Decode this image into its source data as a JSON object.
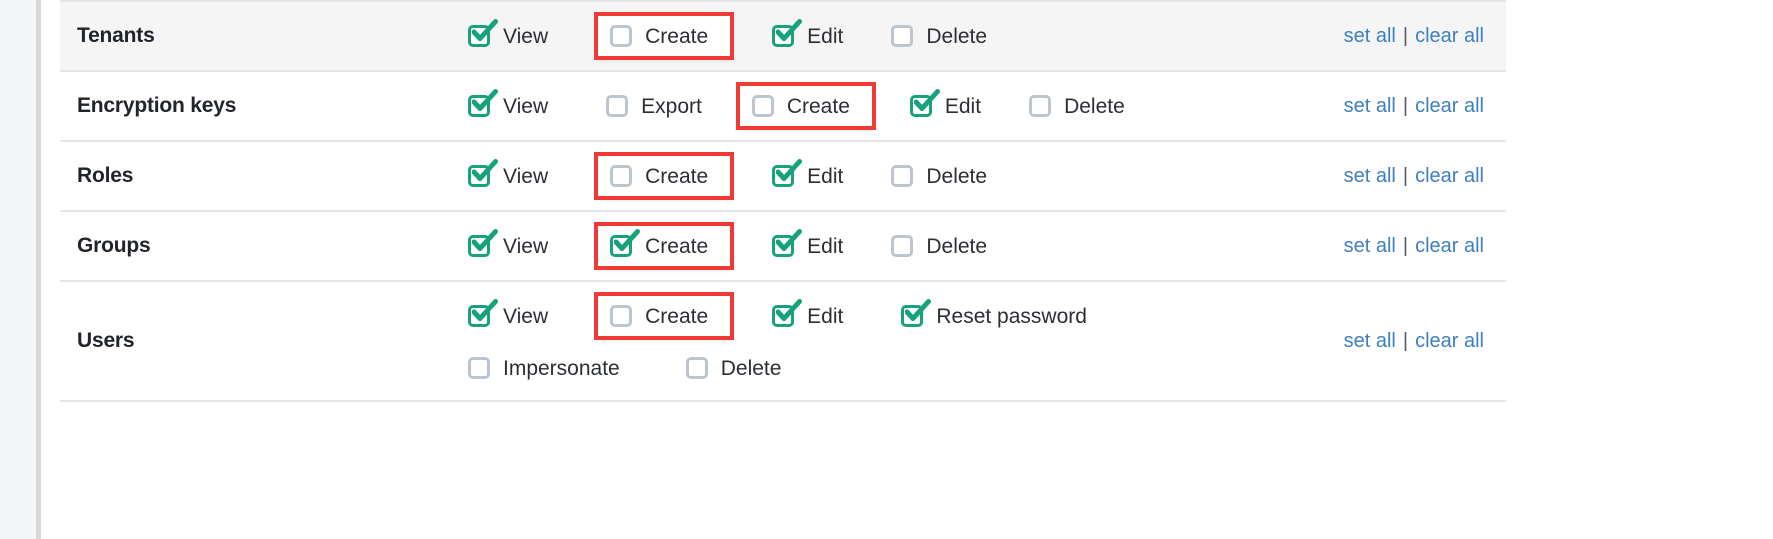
{
  "colors": {
    "checked": "#17a17c",
    "unchecked": "#bcc5cd",
    "highlight": "#ef3b35",
    "link": "#3d7fc1",
    "shaded_row": "#f5f5f6",
    "row_border": "#e2e4e6",
    "text": "#2b2f33"
  },
  "actions": {
    "set_all": "set all",
    "separator": "|",
    "clear_all": "clear all"
  },
  "rows": [
    {
      "name": "Tenants",
      "shaded": true,
      "lines": [
        [
          {
            "label": "View",
            "checked": true,
            "highlighted": false
          },
          {
            "label": "Create",
            "checked": false,
            "highlighted": true
          },
          {
            "label": "Edit",
            "checked": true,
            "highlighted": false
          },
          {
            "label": "Delete",
            "checked": false,
            "highlighted": false
          }
        ]
      ]
    },
    {
      "name": "Encryption keys",
      "shaded": false,
      "lines": [
        [
          {
            "label": "View",
            "checked": true,
            "highlighted": false
          },
          {
            "label": "Export",
            "checked": false,
            "highlighted": false
          },
          {
            "label": "Create",
            "checked": false,
            "highlighted": true
          },
          {
            "label": "Edit",
            "checked": true,
            "highlighted": false
          },
          {
            "label": "Delete",
            "checked": false,
            "highlighted": false
          }
        ]
      ]
    },
    {
      "name": "Roles",
      "shaded": false,
      "lines": [
        [
          {
            "label": "View",
            "checked": true,
            "highlighted": false
          },
          {
            "label": "Create",
            "checked": false,
            "highlighted": true
          },
          {
            "label": "Edit",
            "checked": true,
            "highlighted": false
          },
          {
            "label": "Delete",
            "checked": false,
            "highlighted": false
          }
        ]
      ]
    },
    {
      "name": "Groups",
      "shaded": false,
      "lines": [
        [
          {
            "label": "View",
            "checked": true,
            "highlighted": false
          },
          {
            "label": "Create",
            "checked": true,
            "highlighted": true
          },
          {
            "label": "Edit",
            "checked": true,
            "highlighted": false
          },
          {
            "label": "Delete",
            "checked": false,
            "highlighted": false
          }
        ]
      ]
    },
    {
      "name": "Users",
      "shaded": false,
      "lines": [
        [
          {
            "label": "View",
            "checked": true,
            "highlighted": false
          },
          {
            "label": "Create",
            "checked": false,
            "highlighted": true
          },
          {
            "label": "Edit",
            "checked": true,
            "highlighted": false
          },
          {
            "label": "Reset password",
            "checked": true,
            "highlighted": false
          }
        ],
        [
          {
            "label": "Impersonate",
            "checked": false,
            "highlighted": false
          },
          {
            "label": "Delete",
            "checked": false,
            "highlighted": false
          }
        ]
      ]
    }
  ]
}
